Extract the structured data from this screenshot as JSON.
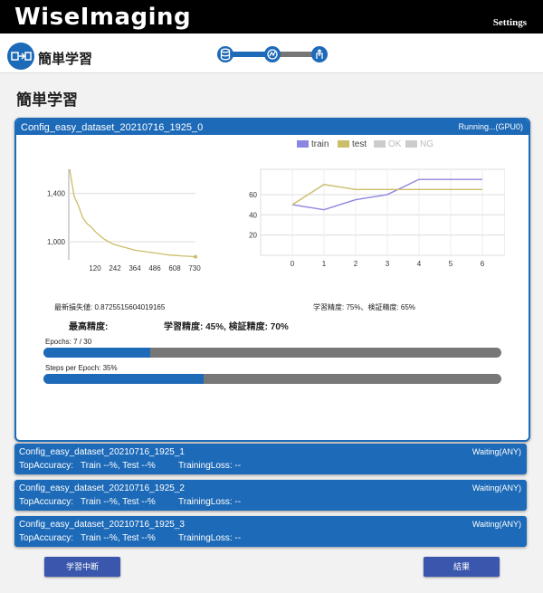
{
  "header": {
    "logo": "WiseImaging",
    "settings_label": "Settings"
  },
  "subheader": {
    "app_title": "簡単学習",
    "app_icon": "flow-icon",
    "steps": [
      {
        "icon": "database-icon"
      },
      {
        "icon": "training-icon"
      },
      {
        "icon": "deploy-icon"
      }
    ]
  },
  "page_title": "簡単学習",
  "colors": {
    "accent": "#1d6ab8",
    "train": "#8c86e0",
    "test": "#cbbd6a",
    "disabled": "#cccccc",
    "bar_bg": "#777777"
  },
  "main_job": {
    "name": "Config_easy_dataset_20210716_1925_0",
    "status": "Running...(GPU0)",
    "legend": [
      {
        "label": "train",
        "color": "#8c86e0"
      },
      {
        "label": "test",
        "color": "#cbbd6a"
      },
      {
        "label": "OK",
        "color": "#cccccc"
      },
      {
        "label": "NG",
        "color": "#cccccc"
      }
    ],
    "latest_loss_text": "最新損失値: 0.8725515604019165",
    "latest_acc_text": "学習精度: 75%、検証精度: 65%",
    "best_label": "最高精度:",
    "best_value": "学習精度: 45%, 検証精度: 70%",
    "epochs_label": "Epochs: 7 / 30",
    "epochs_progress": 0.233,
    "steps_label": "Steps per Epoch: 35%",
    "steps_progress": 0.35
  },
  "chart_data": [
    {
      "type": "line",
      "series": [
        {
          "values": [
            1.6,
            1.38,
            1.3,
            1.2,
            1.15,
            1.12,
            1.08,
            1.05,
            1.02,
            1.0,
            0.98,
            0.97,
            0.96,
            0.95,
            0.94,
            0.93,
            0.925,
            0.92,
            0.915,
            0.91,
            0.905,
            0.9,
            0.895,
            0.89,
            0.888,
            0.885,
            0.882,
            0.88,
            0.878,
            0.875
          ]
        }
      ],
      "x_ticks": [
        "120",
        "242",
        "364",
        "486",
        "608",
        "730"
      ],
      "y_ticks": [
        "1,400",
        "1,000"
      ],
      "ylim": [
        0.85,
        1.6
      ]
    },
    {
      "type": "line",
      "categories": [
        "0",
        "1",
        "2",
        "3",
        "4",
        "5",
        "6"
      ],
      "series": [
        {
          "name": "train",
          "values": [
            50,
            45,
            55,
            60,
            75,
            75,
            75
          ]
        },
        {
          "name": "test",
          "values": [
            50,
            70,
            65,
            65,
            65,
            65,
            65
          ]
        }
      ],
      "y_ticks": [
        "60",
        "40",
        "20"
      ],
      "ylim": [
        0,
        85
      ]
    }
  ],
  "waiting_jobs": [
    {
      "name": "Config_easy_dataset_20210716_1925_1",
      "status": "Waiting(ANY)",
      "acc_label": "TopAccuracy:",
      "acc_value": "Train --%, Test --%",
      "loss_label": "TrainingLoss: --"
    },
    {
      "name": "Config_easy_dataset_20210716_1925_2",
      "status": "Waiting(ANY)",
      "acc_label": "TopAccuracy:",
      "acc_value": "Train --%, Test --%",
      "loss_label": "TrainingLoss: --"
    },
    {
      "name": "Config_easy_dataset_20210716_1925_3",
      "status": "Waiting(ANY)",
      "acc_label": "TopAccuracy:",
      "acc_value": "Train --%, Test --%",
      "loss_label": "TrainingLoss: --"
    }
  ],
  "buttons": {
    "stop": "学習中断",
    "result": "結果"
  }
}
